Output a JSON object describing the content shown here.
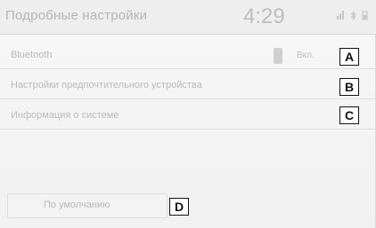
{
  "header": {
    "title": "Подробные настройки",
    "time": "4:29",
    "status_icons": [
      "signal-icon",
      "bluetooth-icon",
      "battery-icon"
    ]
  },
  "rows": [
    {
      "label": "Bluetooth",
      "toggle_text": "Вкл.",
      "marker": "A"
    },
    {
      "label": "Настройки предпочтительного устройства",
      "marker": "B"
    },
    {
      "label": "Информация о системе",
      "marker": "C"
    }
  ],
  "footer": {
    "default_button_label": "По умолчанию",
    "marker": "D"
  }
}
